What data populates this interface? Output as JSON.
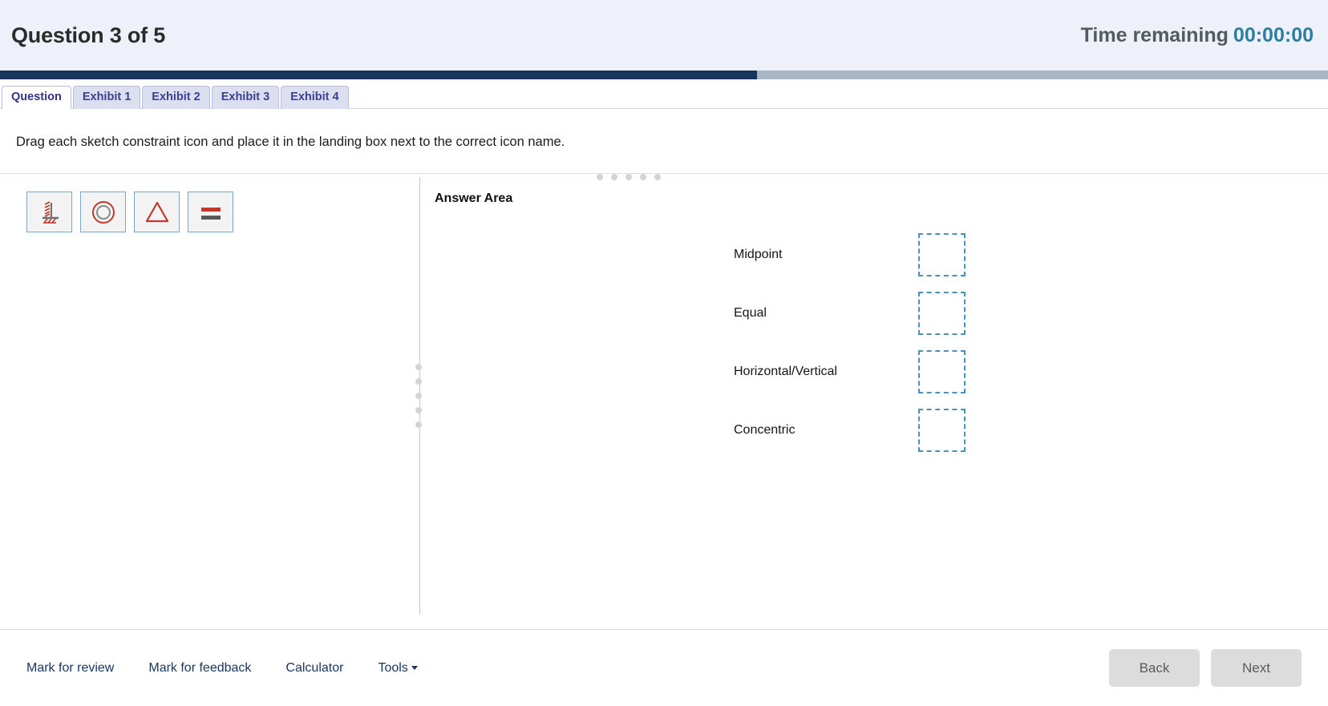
{
  "header": {
    "title": "Question 3 of 5",
    "timer_label": "Time remaining",
    "timer_value": "00:00:00",
    "timer_color": "#2c7ea1"
  },
  "progress": {
    "percent": 57,
    "fill_color": "#16365c",
    "track_color": "#a8b5c7"
  },
  "tabs": [
    {
      "label": "Question",
      "active": true
    },
    {
      "label": "Exhibit 1",
      "active": false
    },
    {
      "label": "Exhibit 2",
      "active": false
    },
    {
      "label": "Exhibit 3",
      "active": false
    },
    {
      "label": "Exhibit 4",
      "active": false
    }
  ],
  "prompt": {
    "text": "Drag each sketch constraint icon and place it in the landing box next to the correct icon name."
  },
  "drag_items": [
    {
      "icon": "fix-ground-constraint-icon",
      "name": "fix-ground"
    },
    {
      "icon": "concentric-circles-icon",
      "name": "concentric"
    },
    {
      "icon": "triangle-outline-icon",
      "name": "triangle"
    },
    {
      "icon": "equal-bars-icon",
      "name": "equal"
    }
  ],
  "answer_area": {
    "title": "Answer Area",
    "rows": [
      {
        "label": "Midpoint",
        "dropped": ""
      },
      {
        "label": "Equal",
        "dropped": ""
      },
      {
        "label": "Horizontal/Vertical",
        "dropped": ""
      },
      {
        "label": "Concentric",
        "dropped": ""
      }
    ]
  },
  "footer": {
    "links": [
      {
        "label": "Mark for review",
        "caret": false
      },
      {
        "label": "Mark for feedback",
        "caret": false
      },
      {
        "label": "Calculator",
        "caret": false
      },
      {
        "label": "Tools",
        "caret": true
      }
    ],
    "back_label": "Back",
    "next_label": "Next"
  },
  "colors": {
    "header_bg": "#eef1f9",
    "accent_red": "#c0392b",
    "accent_gray": "#5a5a5a",
    "tile_border": "#7aa7c7",
    "drop_border": "#4a90b8"
  }
}
